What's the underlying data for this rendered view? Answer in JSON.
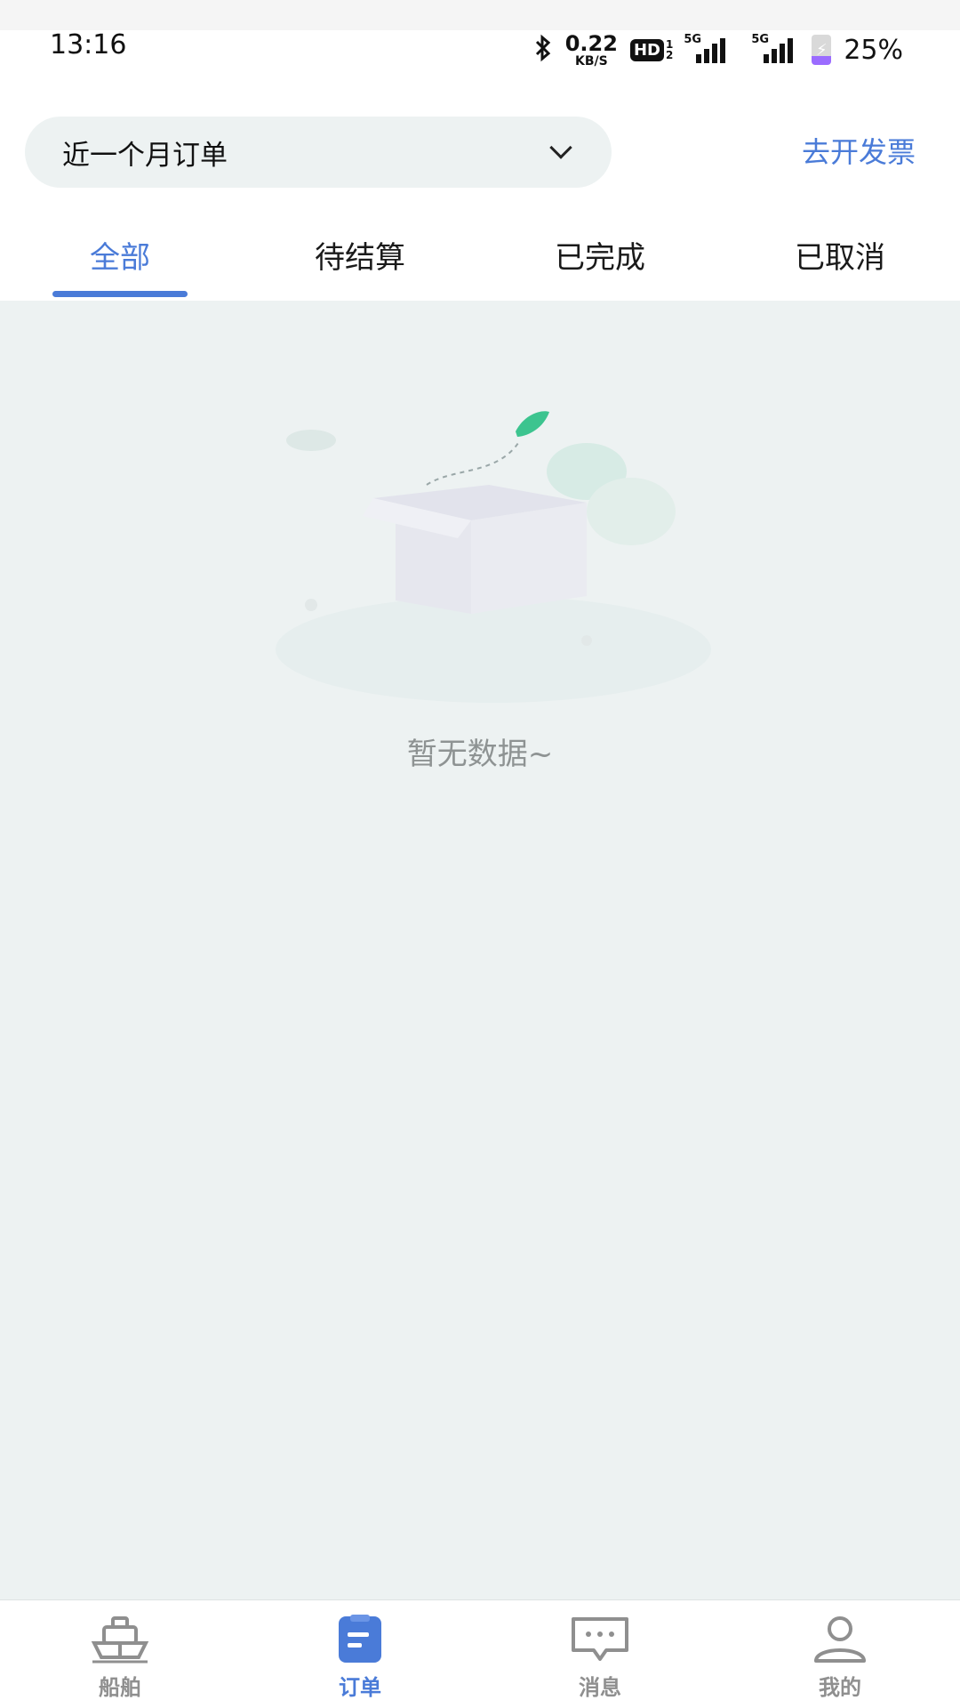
{
  "status_bar": {
    "time": "13:16",
    "net_speed_value": "0.22",
    "net_speed_unit": "KB/S",
    "hd_label": "HD",
    "hd_sub_top": "1",
    "hd_sub_bottom": "2",
    "sim1_label": "5G",
    "sim2_label": "5G",
    "battery_percent": "25%",
    "icons": [
      "bluetooth-icon",
      "hd-icon",
      "signal-icon",
      "signal-icon",
      "battery-charging-icon"
    ]
  },
  "filter": {
    "selected": "近一个月订单",
    "icon": "chevron-down-icon"
  },
  "invoice_link": "去开发票",
  "tabs": [
    {
      "label": "全部",
      "active": true
    },
    {
      "label": "待结算",
      "active": false
    },
    {
      "label": "已完成",
      "active": false
    },
    {
      "label": "已取消",
      "active": false
    }
  ],
  "empty_state": {
    "message": "暂无数据~",
    "icon": "empty-box-illustration"
  },
  "bottom_nav": [
    {
      "label": "船舶",
      "icon": "ship-icon",
      "active": false
    },
    {
      "label": "订单",
      "icon": "order-icon",
      "active": true
    },
    {
      "label": "消息",
      "icon": "message-icon",
      "active": false
    },
    {
      "label": "我的",
      "icon": "profile-icon",
      "active": false
    }
  ],
  "colors": {
    "accent": "#4a7bd8",
    "page_background": "#edf2f2",
    "muted_text": "#8e9393"
  }
}
